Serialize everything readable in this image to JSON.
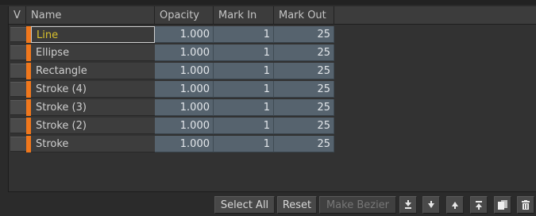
{
  "table": {
    "columns": {
      "v": "V",
      "name": "Name",
      "opacity": "Opacity",
      "mark_in": "Mark In",
      "mark_out": "Mark Out"
    },
    "rows": [
      {
        "name": "Line",
        "opacity": "1.000",
        "mark_in": "1",
        "mark_out": "25"
      },
      {
        "name": "Ellipse",
        "opacity": "1.000",
        "mark_in": "1",
        "mark_out": "25"
      },
      {
        "name": "Rectangle",
        "opacity": "1.000",
        "mark_in": "1",
        "mark_out": "25"
      },
      {
        "name": "Stroke (4)",
        "opacity": "1.000",
        "mark_in": "1",
        "mark_out": "25"
      },
      {
        "name": "Stroke (3)",
        "opacity": "1.000",
        "mark_in": "1",
        "mark_out": "25"
      },
      {
        "name": "Stroke (2)",
        "opacity": "1.000",
        "mark_in": "1",
        "mark_out": "25"
      },
      {
        "name": "Stroke",
        "opacity": "1.000",
        "mark_in": "1",
        "mark_out": "25"
      }
    ],
    "selected_row_index": 0
  },
  "toolbar": {
    "select_all_label": "Select All",
    "reset_label": "Reset",
    "make_bezier_label": "Make Bezier",
    "icons": [
      "move-to-bottom-icon",
      "move-down-icon",
      "move-up-icon",
      "move-to-top-icon",
      "duplicate-icon",
      "delete-icon"
    ]
  },
  "colors": {
    "layer_tag": "#f0771c",
    "selected_name": "#d9c12c",
    "value_cell": "#56636e"
  }
}
